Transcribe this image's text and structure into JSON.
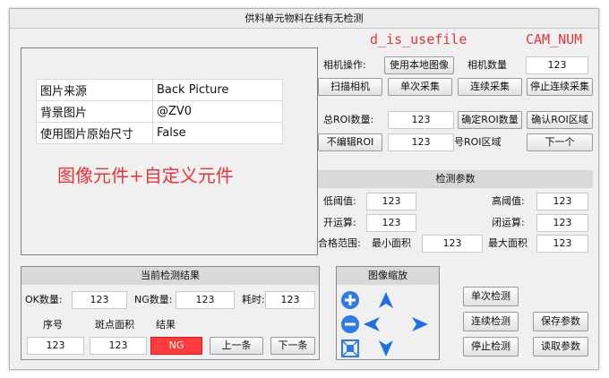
{
  "window": {
    "title": "供料单元物料在线有无检测"
  },
  "annotations": {
    "use_file": "d_is_usefile",
    "cam_num": "CAM_NUM"
  },
  "image_panel": {
    "properties": [
      {
        "key": "图片来源",
        "value": "Back Picture"
      },
      {
        "key": "背景图片",
        "value": "@ZV0"
      },
      {
        "key": "使用图片原始尺寸",
        "value": "False"
      }
    ],
    "caption": "图像元件+自定义元件"
  },
  "camera": {
    "op_label": "相机操作:",
    "use_local_image": "使用本地图像",
    "count_label": "相机数量",
    "count_value": "123",
    "scan": "扫描相机",
    "single_capture": "单次采集",
    "continuous_capture": "连续采集",
    "stop_continuous": "停止连续采集"
  },
  "roi": {
    "total_label": "总ROI数量:",
    "total_value": "123",
    "confirm_count": "确定ROI数量",
    "confirm_area": "确认ROI区域",
    "no_edit": "不编辑ROI",
    "index_value": "123",
    "index_label": "号ROI区域",
    "next": "下一个"
  },
  "params": {
    "title": "检测参数",
    "low_th_label": "低阈值:",
    "low_th": "123",
    "high_th_label": "高阈值:",
    "high_th": "123",
    "open_label": "开运算:",
    "open": "123",
    "close_label": "闭运算:",
    "close": "123",
    "range_label": "合格范围:",
    "min_area_label": "最小面积",
    "min_area": "123",
    "max_area_label": "最大面积",
    "max_area": "123"
  },
  "result": {
    "title": "当前检测结果",
    "ok_label": "OK数量:",
    "ok": "123",
    "ng_label": "NG数量:",
    "ng": "123",
    "time_label": "耗时:",
    "time": "123",
    "seq_label": "序号",
    "area_label": "斑点面积",
    "res_label": "结果",
    "seq": "123",
    "area": "123",
    "res": "NG",
    "prev": "上一条",
    "next": "下一条"
  },
  "zoom": {
    "title": "图像缩放"
  },
  "actions": {
    "single_detect": "单次检测",
    "continuous_detect": "连续检测",
    "save_params": "保存参数",
    "stop_detect": "停止检测",
    "load_params": "读取参数"
  },
  "colors": {
    "accent_red": "#e8343a",
    "ng_red": "#ff3b3b",
    "icon_blue": "#1e6fe6"
  }
}
